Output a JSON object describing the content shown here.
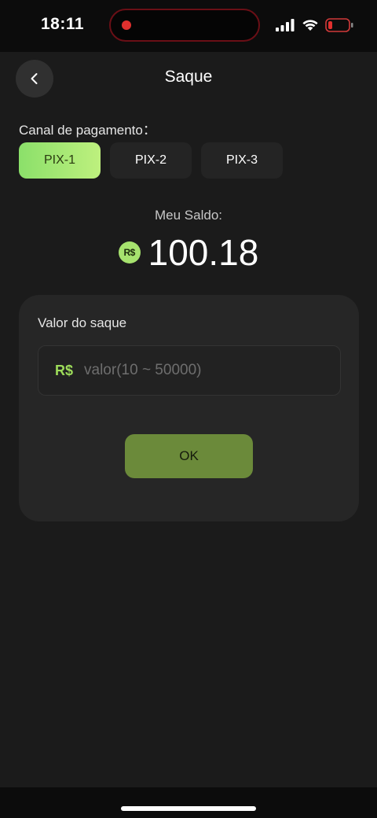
{
  "status_bar": {
    "time": "18:11"
  },
  "header": {
    "title": "Saque",
    "back_icon": "chevron-left-icon"
  },
  "payment_channel": {
    "label": "Canal de pagamento：",
    "tabs": [
      {
        "label": "PIX-1",
        "active": true
      },
      {
        "label": "PIX-2",
        "active": false
      },
      {
        "label": "PIX-3",
        "active": false
      }
    ]
  },
  "balance": {
    "label": "Meu Saldo:",
    "currency_symbol": "R$",
    "value": "100.18"
  },
  "withdraw": {
    "label": "Valor do saque",
    "currency_prefix": "R$",
    "placeholder": "valor(10 ~ 50000)",
    "value": "",
    "submit_label": "OK"
  },
  "colors": {
    "background": "#1b1b1b",
    "accent": "#a6e26e",
    "button": "#6b8a3a",
    "card": "#262626"
  }
}
